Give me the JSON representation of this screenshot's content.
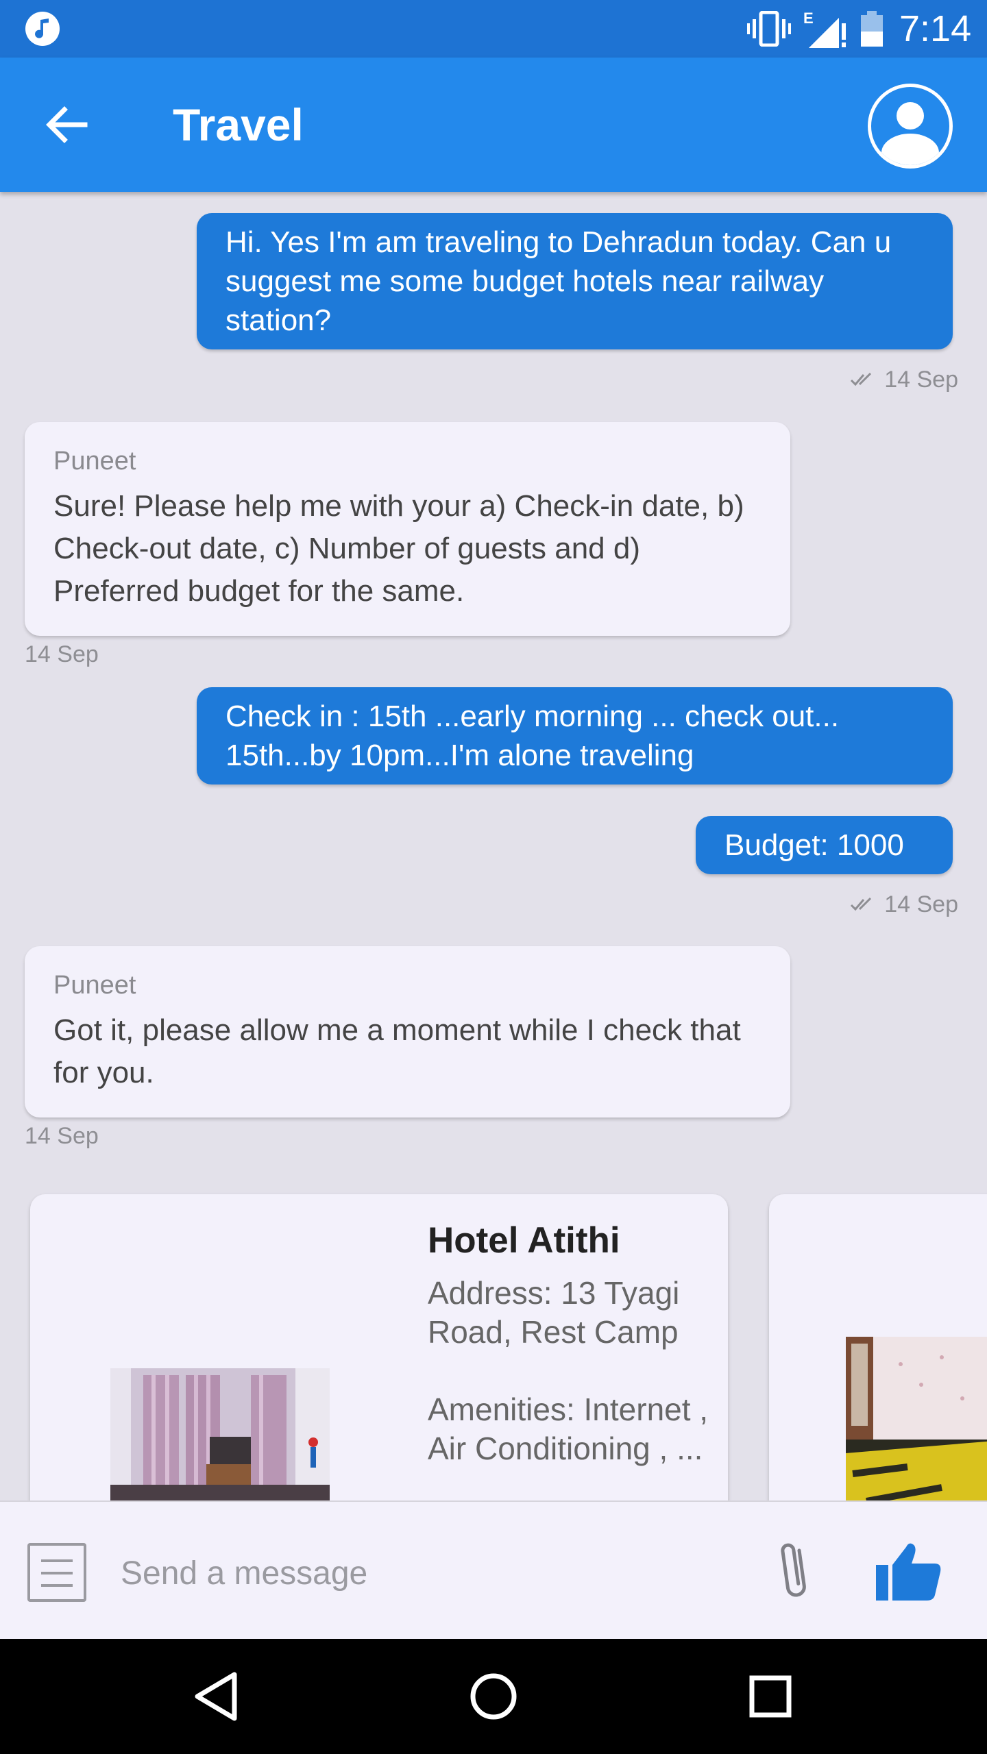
{
  "status_bar": {
    "time": "7:14",
    "network_label": "E",
    "icons": [
      "music-icon",
      "vibrate-icon",
      "signal-icon",
      "battery-icon"
    ]
  },
  "app_bar": {
    "title": "Travel",
    "back_icon": "arrow-back-icon",
    "profile_icon": "account-circle-icon"
  },
  "messages": [
    {
      "direction": "outgoing",
      "text": "Hi. Yes I'm am traveling to Dehradun today. Can u suggest me some budget hotels near railway station?",
      "timestamp": "14 Sep",
      "read": true
    },
    {
      "direction": "incoming",
      "sender": "Puneet",
      "text": "Sure! Please help me with your a) Check-in date, b) Check-out date, c) Number of guests and d) Preferred budget for the same.",
      "timestamp": "14 Sep"
    },
    {
      "direction": "outgoing",
      "text": "Check in : 15th ...early morning ... check out... 15th...by 10pm...I'm alone traveling"
    },
    {
      "direction": "outgoing",
      "text": "Budget: 1000",
      "timestamp": "14 Sep",
      "read": true
    },
    {
      "direction": "incoming",
      "sender": "Puneet",
      "text": "Got it, please allow me a moment while I check that for you.",
      "timestamp": "14 Sep"
    }
  ],
  "hotel_cards": [
    {
      "name": "Hotel Atithi",
      "address": "Address: 13 Tyagi Road, Rest Camp",
      "amenities": "Amenities: Internet , Air Conditioning , ..."
    }
  ],
  "composer": {
    "placeholder": "Send a message",
    "menu_icon": "menu-list-icon",
    "attach_icon": "paperclip-icon",
    "send_icon": "thumbs-up-icon"
  },
  "nav_bar": {
    "icons": [
      "back-triangle-icon",
      "home-circle-icon",
      "recents-square-icon"
    ]
  },
  "colors": {
    "status_bar": "#1e73d3",
    "app_bar": "#2389ec",
    "outgoing_bubble": "#1e7ad9",
    "incoming_bubble": "#f3f1fb",
    "chat_background": "#e3e1ea",
    "like_button": "#1e7ad9"
  }
}
